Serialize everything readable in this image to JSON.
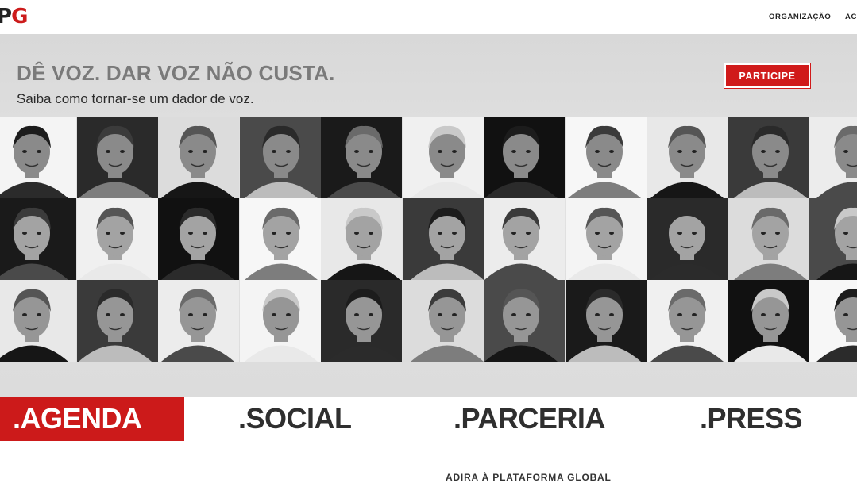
{
  "header": {
    "logo_p": "P",
    "logo_g": "G",
    "nav": [
      "ORGANIZAÇÃO",
      "ACO"
    ]
  },
  "hero": {
    "headline": "DÊ VOZ. DAR VOZ NÃO CUSTA.",
    "subline": "Saiba como tornar-se um dador de voz.",
    "cta_label": "PARTICIPE"
  },
  "tabs": [
    ".AGENDA",
    ".SOCIAL",
    ".PARCERIA",
    ".PRESS"
  ],
  "footer": {
    "heading": "ADIRA À PLATAFORMA GLOBAL"
  },
  "colors": {
    "brand_red": "#cc1a1a",
    "text_dark": "#2f2f2f"
  }
}
